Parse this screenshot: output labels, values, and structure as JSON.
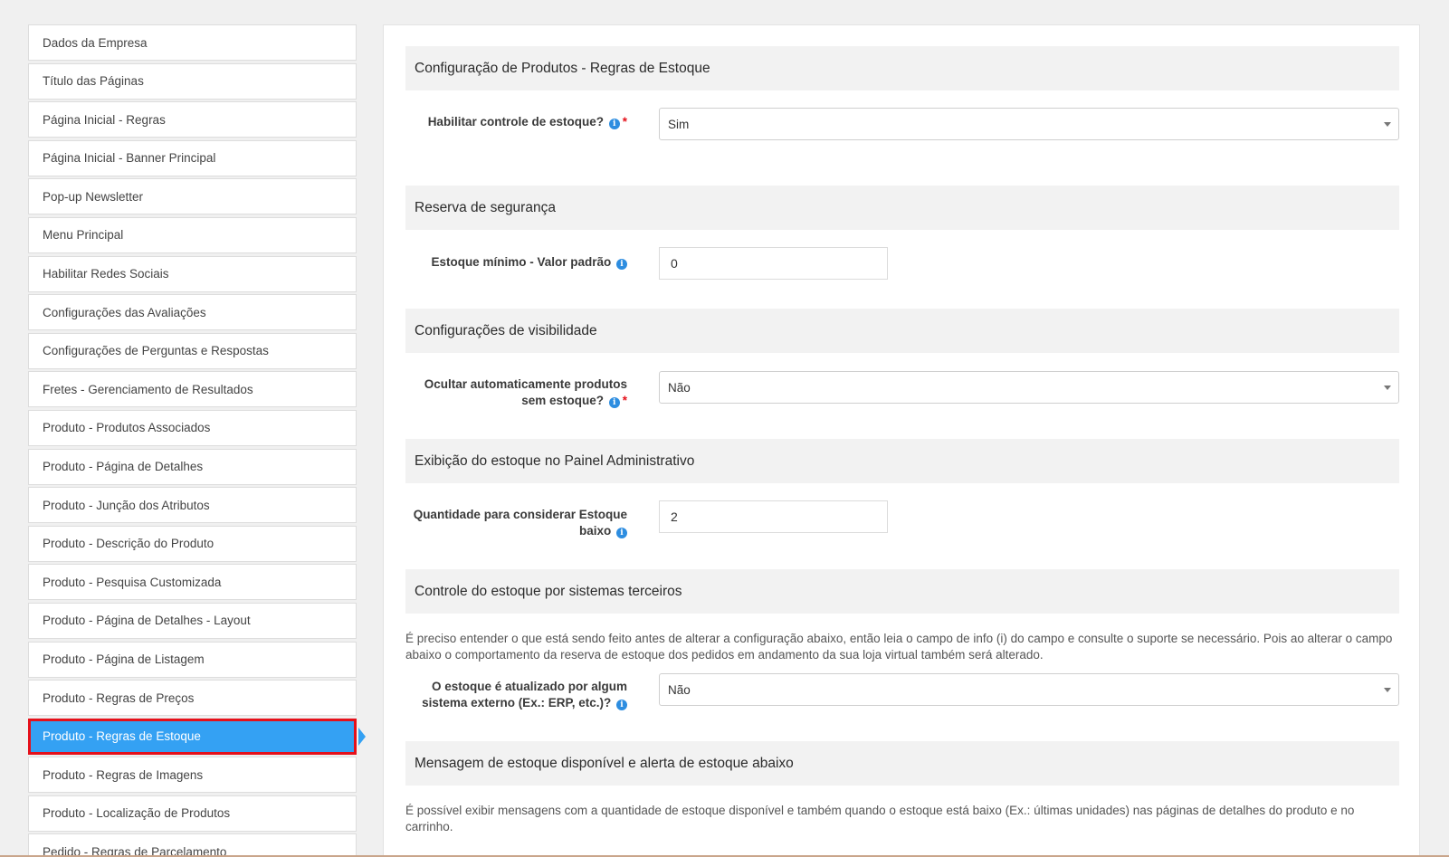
{
  "sidebar": {
    "items": [
      {
        "label": "Dados da Empresa"
      },
      {
        "label": "Título das Páginas"
      },
      {
        "label": "Página Inicial - Regras"
      },
      {
        "label": "Página Inicial - Banner Principal"
      },
      {
        "label": "Pop-up Newsletter"
      },
      {
        "label": "Menu Principal"
      },
      {
        "label": "Habilitar Redes Sociais"
      },
      {
        "label": "Configurações das Avaliações"
      },
      {
        "label": "Configurações de Perguntas e Respostas"
      },
      {
        "label": "Fretes - Gerenciamento de Resultados"
      },
      {
        "label": "Produto - Produtos Associados"
      },
      {
        "label": "Produto - Página de Detalhes"
      },
      {
        "label": "Produto - Junção dos Atributos"
      },
      {
        "label": "Produto - Descrição do Produto"
      },
      {
        "label": "Produto - Pesquisa Customizada"
      },
      {
        "label": "Produto - Página de Detalhes - Layout"
      },
      {
        "label": "Produto - Página de Listagem"
      },
      {
        "label": "Produto - Regras de Preços"
      },
      {
        "label": "Produto - Regras de Estoque"
      },
      {
        "label": "Produto - Regras de Imagens"
      },
      {
        "label": "Produto - Localização de Produtos"
      },
      {
        "label": "Pedido - Regras de Parcelamento"
      }
    ],
    "active_index": 18
  },
  "sections": {
    "s1": {
      "title": "Configuração de Produtos - Regras de Estoque"
    },
    "s2": {
      "title": "Reserva de segurança"
    },
    "s3": {
      "title": "Configurações de visibilidade"
    },
    "s4": {
      "title": "Exibição do estoque no Painel Administrativo"
    },
    "s5": {
      "title": "Controle do estoque por sistemas terceiros"
    },
    "s6": {
      "title": "Mensagem de estoque disponível e alerta de estoque abaixo"
    }
  },
  "fields": {
    "habilitar": {
      "label": "Habilitar controle de estoque?",
      "value": "Sim",
      "required": "*"
    },
    "estoque_minimo": {
      "label": "Estoque mínimo - Valor padrão",
      "value": "0"
    },
    "ocultar": {
      "label_line1": "Ocultar automaticamente produtos",
      "label_line2": "sem estoque?",
      "value": "Não",
      "required": "*"
    },
    "quantidade": {
      "label_line1": "Quantidade para considerar Estoque",
      "label_line2": "baixo",
      "value": "2"
    },
    "externo": {
      "label_line1": "O estoque é atualizado por algum",
      "label_line2": "sistema externo (Ex.: ERP, etc.)?",
      "value": "Não"
    }
  },
  "help": {
    "terceiros": "É preciso entender o que está sendo feito antes de alterar a configuração abaixo, então leia o campo de info (i) do campo e consulte o suporte se necessário. Pois ao alterar o campo abaixo o comportamento da reserva de estoque dos pedidos em andamento da sua loja virtual também será alterado.",
    "mensagem": "É possível exibir mensagens com a quantidade de estoque disponível e também quando o estoque está baixo (Ex.: últimas unidades) nas páginas de detalhes do produto e no carrinho."
  },
  "icons": {
    "info": "info-icon",
    "dropdown": "chevron-down-icon"
  },
  "colors": {
    "active_bg": "#34a1f3",
    "active_border": "#e5101a",
    "info_icon": "#2d8de0",
    "required": "#e5101a"
  }
}
